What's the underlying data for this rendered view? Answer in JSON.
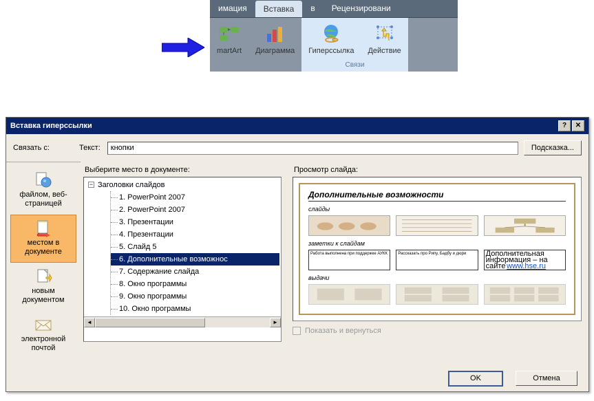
{
  "ribbon": {
    "tabs": [
      "имация",
      "Вставка",
      "в",
      "Рецензировани"
    ],
    "active_tab": "Вставка",
    "buttons": {
      "smartart": "martArt",
      "chart": "Диаграмма",
      "hyperlink": "Гиперссылка",
      "action": "Действие"
    },
    "group_links_label": "Связи"
  },
  "dialog": {
    "title": "Вставка гиперссылки",
    "link_to_label": "Связать с:",
    "text_label": "Текст:",
    "text_value": "кнопки",
    "tip_button": "Подсказка...",
    "sidebar": [
      {
        "id": "file-web",
        "label": "файлом, веб-страницей"
      },
      {
        "id": "place-doc",
        "label": "местом в документе"
      },
      {
        "id": "new-doc",
        "label": "новым документом"
      },
      {
        "id": "email",
        "label": "электронной почтой"
      }
    ],
    "tree_label": "Выберите место в документе:",
    "tree_root": "Заголовки слайдов",
    "tree_items": [
      "1. PowerPoint 2007",
      "2. PowerPoint 2007",
      "3. Презентации",
      "4. Презентации",
      "5. Слайд 5",
      "6. Дополнительные возможнос",
      "7. Содержание слайда",
      "8. Окно программы",
      "9. Окно программы",
      "10. Окно программы"
    ],
    "tree_selected_index": 5,
    "preview_label": "Просмотр слайда:",
    "slide": {
      "title": "Дополнительные возможности",
      "section_slides": "слайды",
      "section_notes": "заметки к слайдам",
      "section_handouts": "выдачи",
      "box1": "Работа выполнена при поддержке АУКК",
      "box2": "Рассказать про Рипу, Бадбу и дюри",
      "box3_a": "Дополнительная информация – на сайте",
      "box3_b": "www.hse.ru"
    },
    "show_return_label": "Показать и вернуться",
    "ok": "OK",
    "cancel": "Отмена"
  }
}
